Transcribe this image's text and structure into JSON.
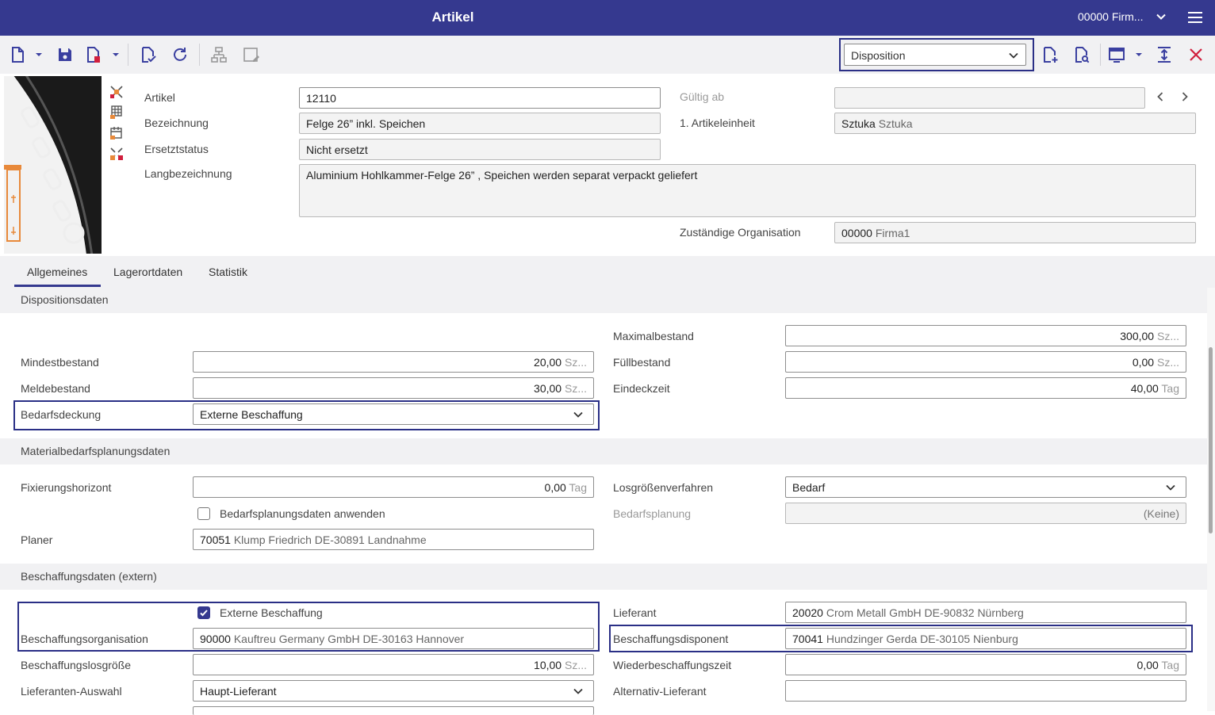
{
  "titlebar": {
    "title": "Artikel",
    "organization": "00000 Firm...",
    "background": "#35398f"
  },
  "toolbar": {
    "icons": [
      "new-document-icon",
      "save-icon",
      "delete-document-icon",
      "validate-icon",
      "refresh-icon",
      "hierarchy-icon",
      "edit-note-icon",
      "add-document-icon",
      "search-document-icon",
      "window-icon",
      "fit-height-icon",
      "close-icon"
    ],
    "view_select": "Disposition"
  },
  "header": {
    "artikel_label": "Artikel",
    "artikel_value": "12110",
    "bezeichnung_label": "Bezeichnung",
    "bezeichnung_value": "Felge  26” inkl. Speichen",
    "ersetztstatus_label": "Ersetztstatus",
    "ersetztstatus_value": "Nicht ersetzt",
    "langbezeichnung_label": "Langbezeichnung",
    "langbezeichnung_value": "Aluminium Hohlkammer-Felge  26” , Speichen werden separat verpackt geliefert",
    "gueltig_label": "Gültig ab",
    "gueltig_value": "",
    "artikeleinheit_label": "1. Artikeleinheit",
    "artikeleinheit_code": "Sztuka",
    "artikeleinheit_desc": "Sztuka",
    "zustaendig_label": "Zuständige Organisation",
    "zustaendig_code": "00000",
    "zustaendig_desc": "Firma1"
  },
  "tabs": [
    {
      "label": "Allgemeines",
      "active": true
    },
    {
      "label": "Lagerortdaten",
      "active": false
    },
    {
      "label": "Statistik",
      "active": false
    }
  ],
  "dispositionsdaten": {
    "section_title": "Dispositionsdaten",
    "maximalbestand_label": "Maximalbestand",
    "maximalbestand_value": "300,00",
    "maximalbestand_unit": "Sz...",
    "mindestbestand_label": "Mindestbestand",
    "mindestbestand_value": "20,00",
    "mindestbestand_unit": "Sz...",
    "fuellbestand_label": "Füllbestand",
    "fuellbestand_value": "0,00",
    "fuellbestand_unit": "Sz...",
    "meldebestand_label": "Meldebestand",
    "meldebestand_value": "30,00",
    "meldebestand_unit": "Sz...",
    "eindeckzeit_label": "Eindeckzeit",
    "eindeckzeit_value": "40,00",
    "eindeckzeit_unit": "Tag",
    "bedarfsdeckung_label": "Bedarfsdeckung",
    "bedarfsdeckung_value": "Externe Beschaffung"
  },
  "materialbedarf": {
    "section_title": "Materialbedarfsplanungsdaten",
    "fixierungshorizont_label": "Fixierungshorizont",
    "fixierungshorizont_value": "0,00",
    "fixierungshorizont_unit": "Tag",
    "losgroessen_label": "Losgrößenverfahren",
    "losgroessen_value": "Bedarf",
    "anwenden_label": "Bedarfsplanungsdaten anwenden",
    "anwenden_checked": false,
    "bedarfsplanung_label": "Bedarfsplanung",
    "bedarfsplanung_value": "(Keine)",
    "planer_label": "Planer",
    "planer_code": "70051",
    "planer_desc": "Klump Friedrich DE-30891 Landnahme"
  },
  "beschaffung": {
    "section_title": "Beschaffungsdaten (extern)",
    "externe_label": "Externe Beschaffung",
    "externe_checked": true,
    "lieferant_label": "Lieferant",
    "lieferant_code": "20020",
    "lieferant_desc": "Crom Metall GmbH  DE-90832 Nürnberg",
    "organisation_label": "Beschaffungsorganisation",
    "organisation_code": "90000",
    "organisation_desc": "Kauftreu Germany GmbH DE-30163 Hannover",
    "disponent_label": "Beschaffungsdisponent",
    "disponent_code": "70041",
    "disponent_desc": "Hundzinger Gerda DE-30105 Nienburg",
    "losgroesse_label": "Beschaffungslosgröße",
    "losgroesse_value": "10,00",
    "losgroesse_unit": "Sz...",
    "wiederbeschaffung_label": "Wiederbeschaffungszeit",
    "wiederbeschaffung_value": "0,00",
    "wiederbeschaffung_unit": "Tag",
    "auswahl_label": "Lieferanten-Auswahl",
    "auswahl_value": "Haupt-Lieferant",
    "alternativ_label": "Alternativ-Lieferant",
    "alternativ_value": ""
  }
}
